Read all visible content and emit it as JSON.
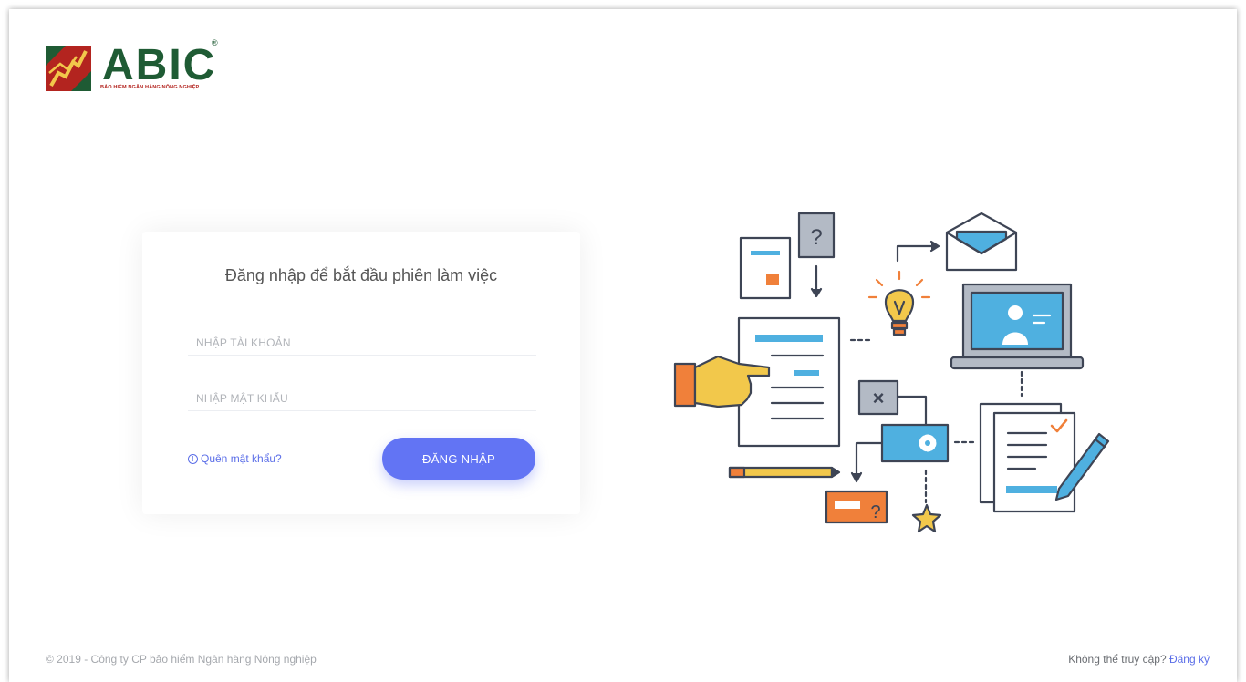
{
  "brand": {
    "name": "ABIC",
    "registered": "®",
    "tagline": "BẢO HIỂM NGÂN HÀNG NÔNG NGHIỆP",
    "colors": {
      "green": "#1f5b34",
      "red": "#b3241f",
      "yellow": "#f2c84b"
    }
  },
  "login": {
    "title": "Đăng nhập để bắt đầu phiên làm việc",
    "username_placeholder": "NHẬP TÀI KHOẢN",
    "password_placeholder": "NHẬP MẬT KHẨU",
    "forgot_icon": "!",
    "forgot_label": "Quên mật khẩu?",
    "submit_label": "ĐĂNG NHẬP",
    "accent": "#6274f4"
  },
  "illustration": {
    "question_mark": "?",
    "close_mark": "×",
    "icons": [
      "document-icon",
      "question-box-icon",
      "envelope-icon",
      "lightbulb-icon",
      "laptop-user-icon",
      "pointing-hand-icon",
      "close-box-icon",
      "settings-box-icon",
      "pencil-icon",
      "checklist-pen-icon",
      "star-icon",
      "question-tag-icon"
    ]
  },
  "footer": {
    "copyright": "© 2019 - Công ty CP bảo hiểm Ngân hàng Nông nghiệp",
    "cannot_access": "Không thể truy cập?",
    "register": "Đăng ký"
  }
}
